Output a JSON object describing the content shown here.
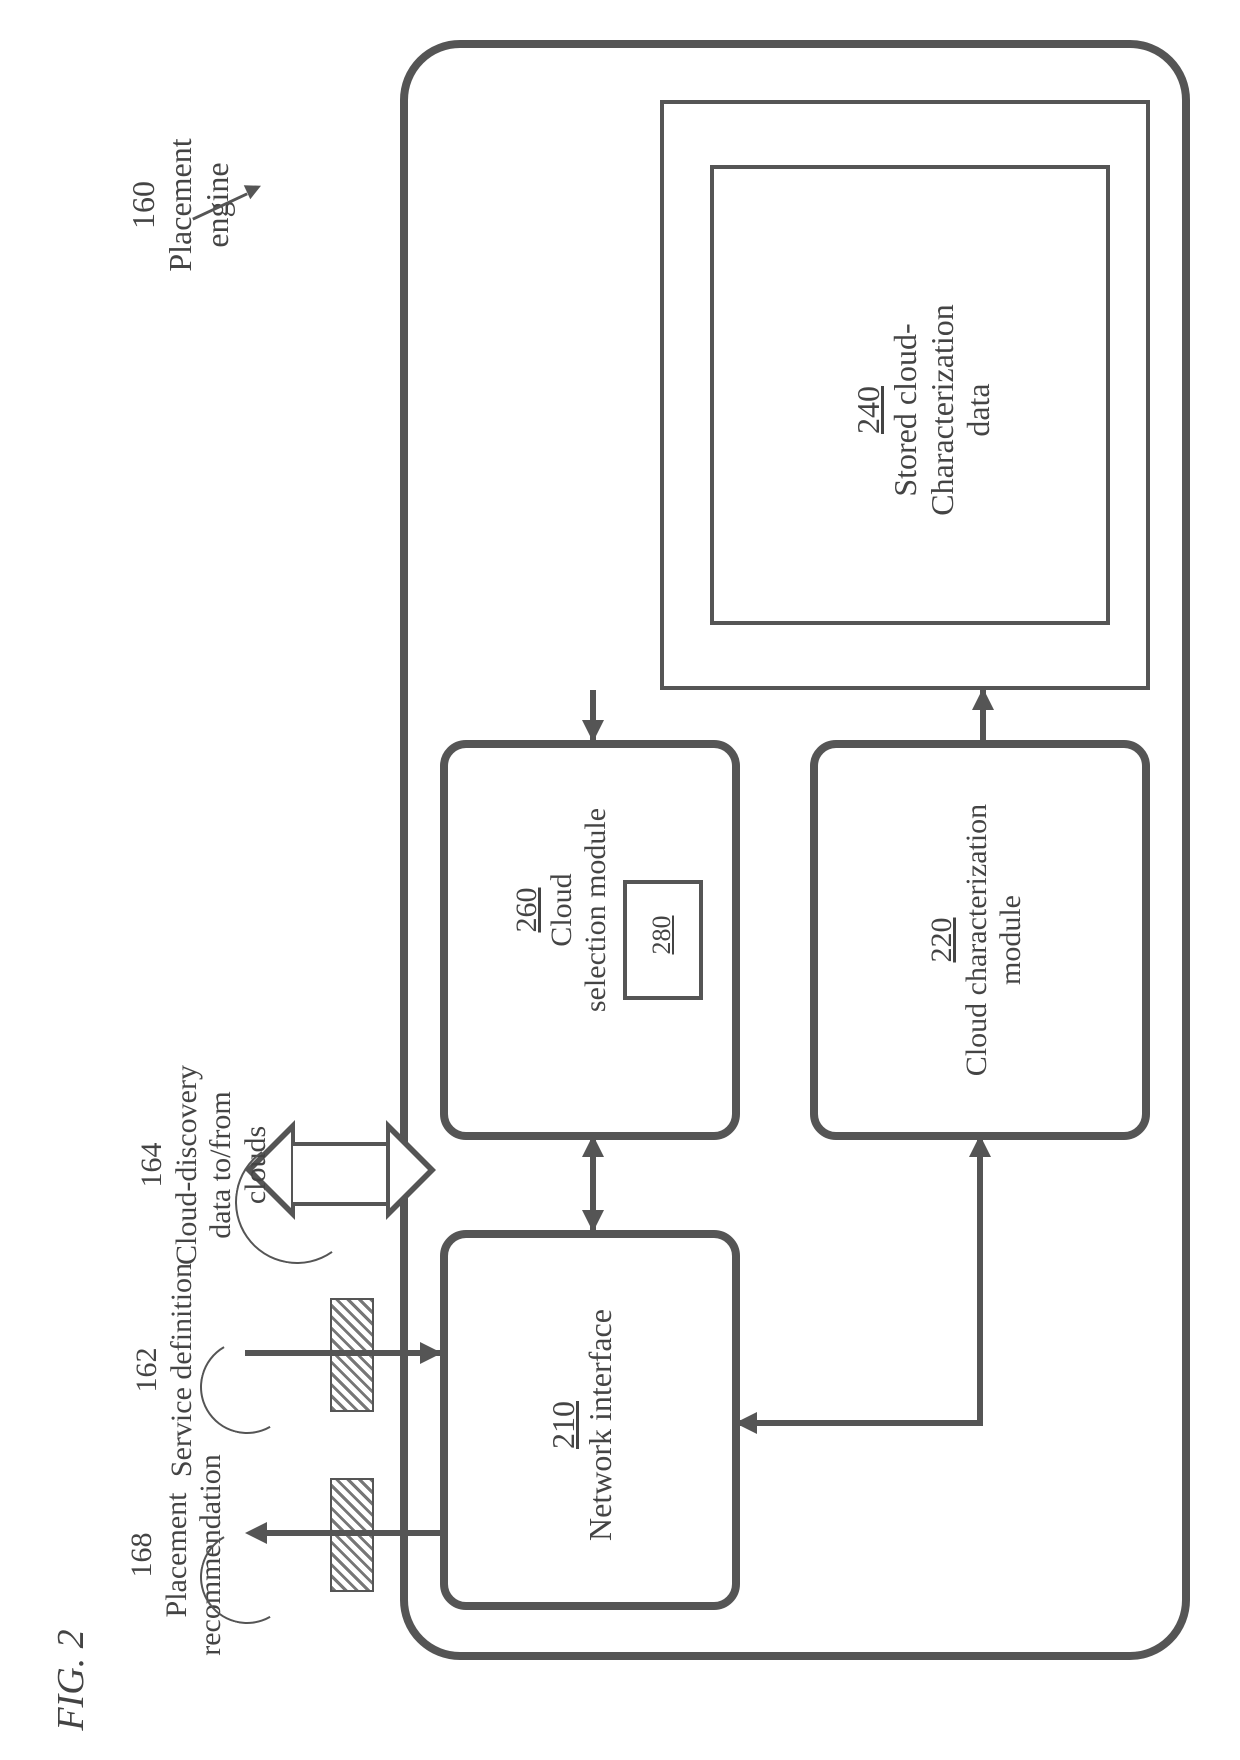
{
  "figure_label": "FIG. 2",
  "chart_data": {
    "type": "diagram",
    "title": "Placement engine (160)",
    "nodes": [
      {
        "id": "160",
        "label": "Placement engine",
        "kind": "container"
      },
      {
        "id": "210",
        "label": "Network interface",
        "kind": "module"
      },
      {
        "id": "220",
        "label": "Cloud characterization module",
        "kind": "module"
      },
      {
        "id": "260",
        "label": "Cloud selection module",
        "kind": "module"
      },
      {
        "id": "280",
        "label": "",
        "kind": "sub-module",
        "parent": "260"
      },
      {
        "id": "storage",
        "label": "",
        "kind": "storage-block"
      },
      {
        "id": "240",
        "label": "Stored cloud-Characterization data",
        "kind": "data",
        "parent": "storage"
      }
    ],
    "edges": [
      {
        "from": "210",
        "to": "260",
        "dir": "both"
      },
      {
        "from": "210",
        "to": "220",
        "dir": "both"
      },
      {
        "from": "220",
        "to": "240",
        "dir": "into"
      },
      {
        "from": "240",
        "to": "260",
        "dir": "into"
      }
    ],
    "external_flows": [
      {
        "id": "164",
        "label": "Cloud-discovery data to/from clouds",
        "dir": "both",
        "with": "210"
      },
      {
        "id": "162",
        "label": "Service definition",
        "dir": "into",
        "with": "210"
      },
      {
        "id": "168",
        "label": "Placement recommendation",
        "dir": "out",
        "with": "210"
      }
    ]
  },
  "labels": {
    "engine_num": "160",
    "engine_text": "Placement\nengine",
    "net_num": "210",
    "net_text": "Network interface",
    "cchar_num": "220",
    "cchar_text": "Cloud characterization\nmodule",
    "csel_num": "260",
    "csel_text": "Cloud\nselection module",
    "sub_num": "280",
    "stored_num": "240",
    "stored_text": "Stored cloud-\nCharacterization\ndata",
    "flow164_num": "164",
    "flow164_text": "Cloud-discovery\ndata to/from\nclouds",
    "flow162_num": "162",
    "flow162_text": "Service definition",
    "flow168_num": "168",
    "flow168_text": "Placement\nrecommendation"
  }
}
